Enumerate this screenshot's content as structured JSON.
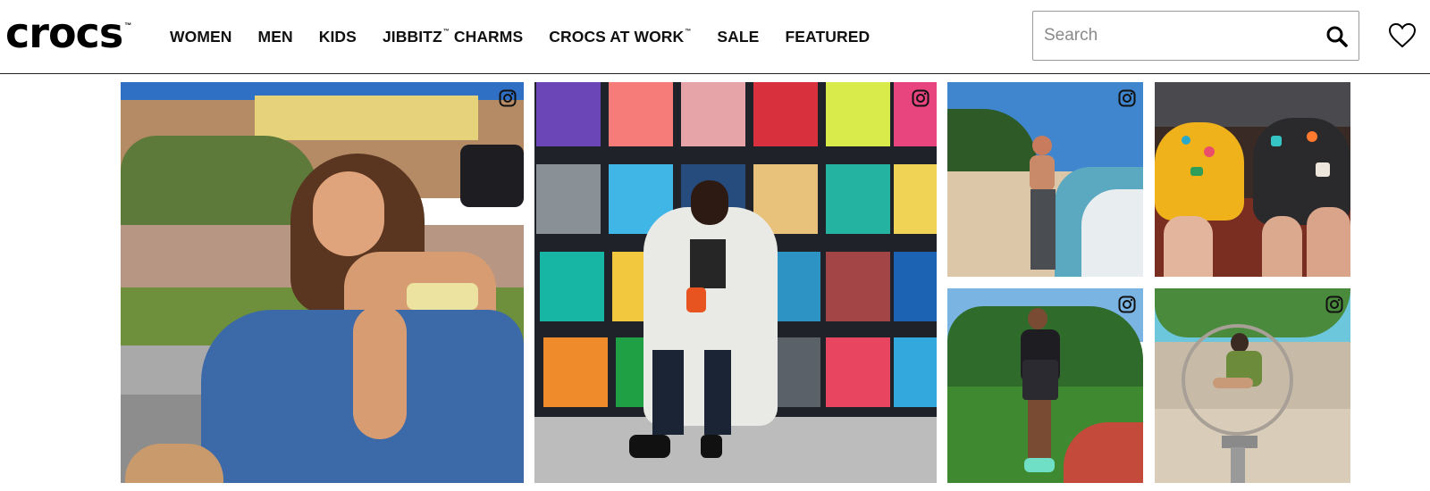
{
  "brand": {
    "logo_text": "crocs",
    "logo_mark": "™"
  },
  "nav": {
    "items": [
      {
        "label": "WOMEN",
        "tm": ""
      },
      {
        "label": "MEN",
        "tm": ""
      },
      {
        "label": "KIDS",
        "tm": ""
      },
      {
        "label": "JIBBITZ",
        "tm": "™",
        "suffix": " CHARMS"
      },
      {
        "label": "CROCS AT WORK",
        "tm": "™",
        "suffix": ""
      },
      {
        "label": "SALE",
        "tm": ""
      },
      {
        "label": "FEATURED",
        "tm": ""
      }
    ]
  },
  "search": {
    "placeholder": "Search",
    "value": ""
  },
  "icons": {
    "search": "search-icon",
    "wishlist": "heart-icon",
    "instagram": "instagram-icon"
  },
  "gallery": {
    "tiles": [
      {
        "id": "tile-1",
        "icon": "instagram-icon"
      },
      {
        "id": "tile-2",
        "icon": "instagram-icon"
      },
      {
        "id": "tile-3",
        "icon": "instagram-icon"
      },
      {
        "id": "tile-4",
        "icon": ""
      },
      {
        "id": "tile-5",
        "icon": "instagram-icon"
      },
      {
        "id": "tile-6",
        "icon": "instagram-icon"
      }
    ]
  },
  "colors": {
    "text": "#111111",
    "border": "#222222",
    "search_border": "#9a9a9a"
  }
}
